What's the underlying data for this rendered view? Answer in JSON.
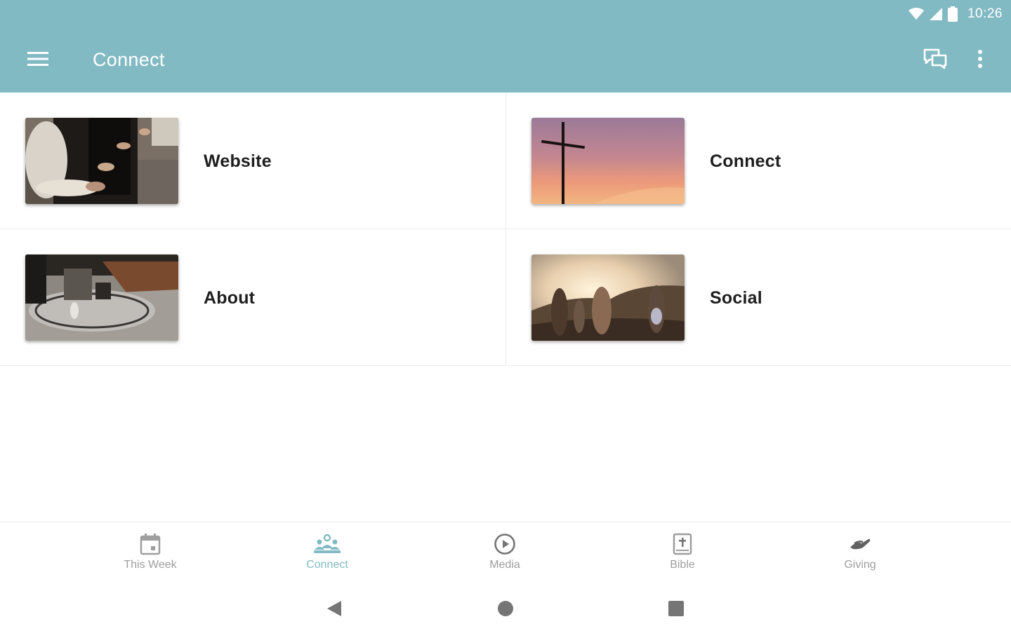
{
  "status_bar": {
    "time": "10:26"
  },
  "app_bar": {
    "title": "Connect",
    "menu_icon": "hamburger-menu-icon",
    "chat_icon": "chat-icon",
    "more_icon": "more-vert-icon",
    "background_color": "#82bac3"
  },
  "tiles": [
    {
      "label": "Website",
      "image": "hands-worship-photo"
    },
    {
      "label": "Connect",
      "image": "cross-sunset-photo"
    },
    {
      "label": "About",
      "image": "living-room-table-photo"
    },
    {
      "label": "Social",
      "image": "friends-hillside-sunset-photo"
    }
  ],
  "bottom_nav": {
    "active_color": "#82bac3",
    "inactive_color": "#9e9e9e",
    "items": [
      {
        "label": "This Week",
        "icon": "calendar-icon",
        "active": false
      },
      {
        "label": "Connect",
        "icon": "people-group-icon",
        "active": true
      },
      {
        "label": "Media",
        "icon": "play-circle-icon",
        "active": false
      },
      {
        "label": "Bible",
        "icon": "bible-icon",
        "active": false
      },
      {
        "label": "Giving",
        "icon": "giving-hand-icon",
        "active": false
      }
    ]
  },
  "system_nav": {
    "back_icon": "back-triangle-icon",
    "home_icon": "home-circle-icon",
    "recents_icon": "recents-square-icon"
  }
}
